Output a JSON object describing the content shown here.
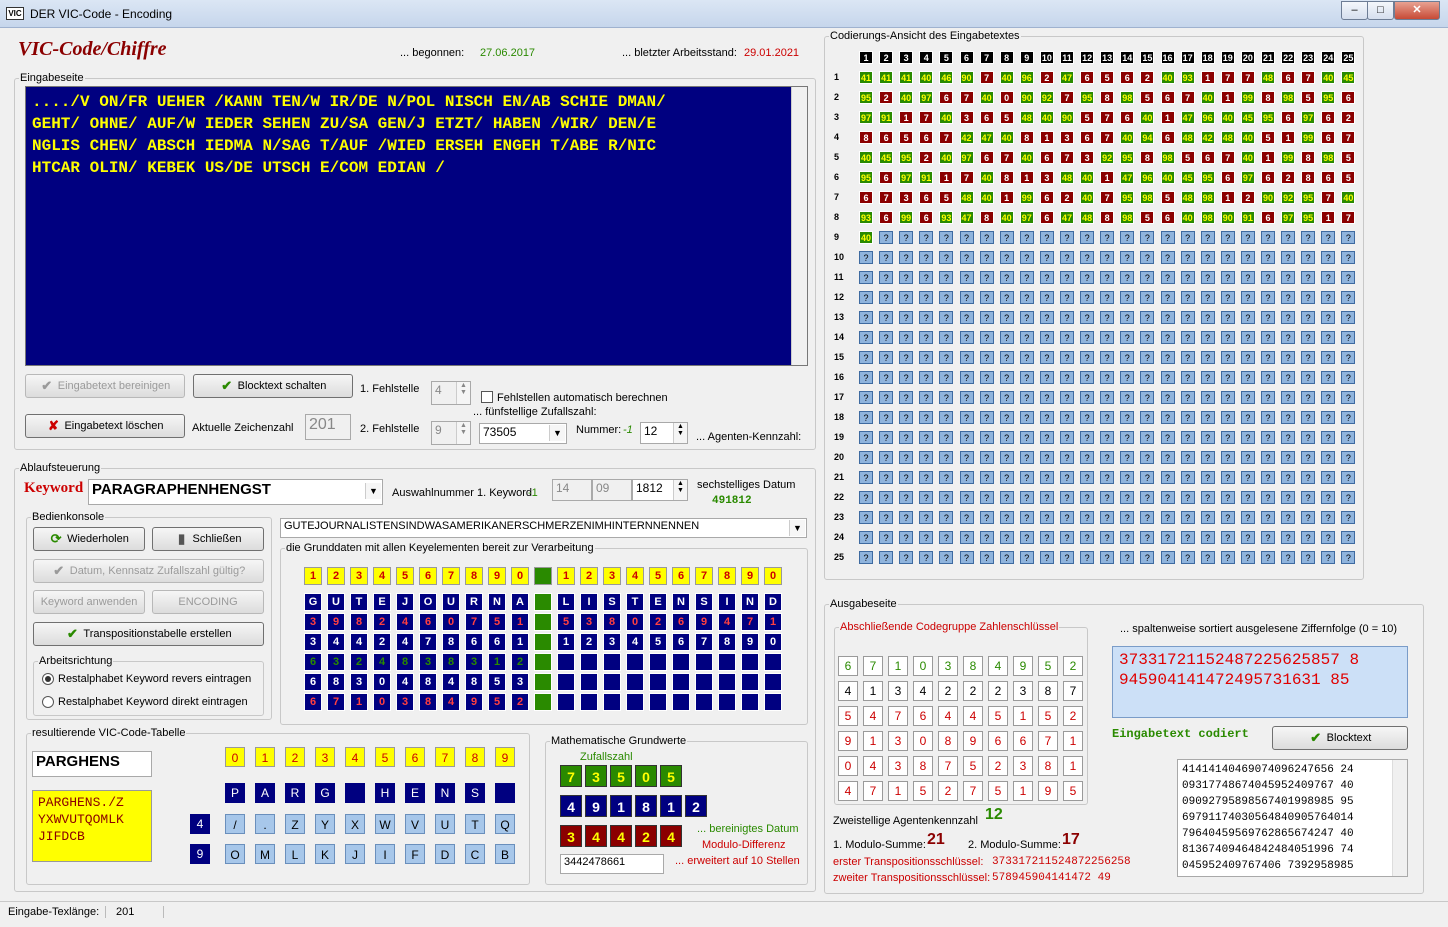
{
  "window": {
    "title": "DER VIC-Code - Encoding",
    "icon": "VIC",
    "min": "–",
    "max": "□",
    "close": "✕"
  },
  "header": {
    "app_title": "VIC-Code/Chiffre",
    "begonnen_label": "... begonnen:",
    "begonnen_value": "27.06.2017",
    "stand_label": "... bletzter Arbeitsstand:",
    "stand_value": "29.01.2021"
  },
  "eingabe": {
    "legend": "Eingabeseite",
    "lines": [
      "..../V ON/FR UEHER /KANN TEN/W IR/DE N/POL NISCH EN/AB SCHIE DMAN/",
      "GEHT/ OHNE/ AUF/W IEDER SEHEN ZU/SA GEN/J ETZT/ HABEN /WIR/ DEN/E",
      "NGLIS CHEN/ ABSCH IEDMA N/SAG T/AUF /WIED ERSEH ENGEH T/ABE R/NIC",
      "HTCAR OLIN/ KEBEK US/DE UTSCH E/COM EDIAN /"
    ]
  },
  "controls": {
    "bereinigen": "Eingabetext bereinigen",
    "blocktext": "Blocktext schalten",
    "loeschen": "Eingabetext löschen",
    "zeichenzahl_label": "Aktuelle Zeichenzahl",
    "zeichenzahl": "201",
    "f1_label": "1. Fehlstelle",
    "f1": "4",
    "f2_label": "2. Fehlstelle",
    "f2": "9",
    "auto_label": "Fehlstellen automatisch berechnen",
    "zufall_label": "... fünfstellige Zufallszahl:",
    "zufall": "73505",
    "nummer_label": "Nummer:",
    "nummer_val": "-1",
    "agent": "12",
    "agent_label": "... Agenten-Kennzahl:"
  },
  "ablauf": {
    "legend": "Ablaufsteuerung",
    "keyword_label": "Keyword",
    "keyword": "PARAGRAPHENHENGST",
    "auswahl_label": "Auswahlnummer 1. Keyword",
    "auswahl_val": "-1",
    "d1": "14",
    "d2": "09",
    "d3": "1812",
    "datum_label": "sechstelliges Datum",
    "datum": "491812",
    "phrase": "GUTEJOURNALISTENSINDWASAMERIKANERSCHMERZENIMHINTERNNENNEN",
    "grund_legend": "die Grunddaten mit allen Keyelementen bereit zur Verarbeitung"
  },
  "bedien": {
    "legend": "Bedienkonsole",
    "wiederholen": "Wiederholen",
    "schliessen": "Schließen",
    "datum_check": "Datum, Kennsatz Zufallszahl gültig?",
    "keyword_anwenden": "Keyword anwenden",
    "encoding": "ENCODING",
    "transposition": "Transpositionstabelle erstellen",
    "richtung_legend": "Arbeitsrichtung",
    "radio1": "Restalphabet Keyword revers eintragen",
    "radio2": "Restalphabet Keyword direkt eintragen"
  },
  "key_grid": {
    "header": [
      "1",
      "2",
      "3",
      "4",
      "5",
      "6",
      "7",
      "8",
      "9",
      "0",
      "",
      "1",
      "2",
      "3",
      "4",
      "5",
      "6",
      "7",
      "8",
      "9",
      "0"
    ],
    "rows": [
      [
        "G",
        "U",
        "T",
        "E",
        "J",
        "O",
        "U",
        "R",
        "N",
        "A",
        "",
        "L",
        "I",
        "S",
        "T",
        "E",
        "N",
        "S",
        "I",
        "N",
        "D"
      ],
      [
        "3",
        "9",
        "8",
        "2",
        "4",
        "6",
        "0",
        "7",
        "5",
        "1",
        "",
        "5",
        "3",
        "8",
        "0",
        "2",
        "6",
        "9",
        "4",
        "7",
        "1"
      ],
      [
        "3",
        "4",
        "4",
        "2",
        "4",
        "7",
        "8",
        "6",
        "6",
        "1",
        "",
        "1",
        "2",
        "3",
        "4",
        "5",
        "6",
        "7",
        "8",
        "9",
        "0"
      ],
      [
        "6",
        "3",
        "2",
        "4",
        "8",
        "3",
        "8",
        "3",
        "1",
        "2",
        "",
        "",
        "",
        "",
        "",
        "",
        "",
        "",
        "",
        "",
        ""
      ],
      [
        "6",
        "8",
        "3",
        "0",
        "4",
        "8",
        "4",
        "8",
        "5",
        "3",
        "",
        "",
        "",
        "",
        "",
        "",
        "",
        "",
        "",
        "",
        ""
      ],
      [
        "6",
        "7",
        "1",
        "0",
        "3",
        "8",
        "4",
        "9",
        "5",
        "2",
        "",
        "",
        "",
        "",
        "",
        "",
        "",
        "",
        "",
        "",
        ""
      ]
    ]
  },
  "vic_table": {
    "legend": "resultierende VIC-Code-Tabelle",
    "word": "PARGHENS",
    "alphabet": [
      "PARGHENS./Z",
      "YXWVUTQOMLK",
      "JIFDCB"
    ],
    "header": [
      "0",
      "1",
      "2",
      "3",
      "4",
      "5",
      "6",
      "7",
      "8",
      "9"
    ],
    "row0": [
      "P",
      "A",
      "R",
      "G",
      "",
      "H",
      "E",
      "N",
      "S",
      ""
    ],
    "row4_label": "4",
    "row4": [
      "/",
      ".",
      "Z",
      "Y",
      "X",
      "W",
      "V",
      "U",
      "T",
      "Q"
    ],
    "row9_label": "9",
    "row9": [
      "O",
      "M",
      "L",
      "K",
      "J",
      "I",
      "F",
      "D",
      "C",
      "B"
    ]
  },
  "math": {
    "legend": "Mathematische Grundwerte",
    "zufall_label": "Zufallszahl",
    "zufall": [
      "7",
      "3",
      "5",
      "0",
      "5"
    ],
    "datum": [
      "4",
      "9",
      "1",
      "8",
      "1",
      "2"
    ],
    "diff": [
      "3",
      "4",
      "4",
      "2",
      "4"
    ],
    "bereinigt": "... bereinigtes Datum",
    "modulo": "Modulo-Differenz",
    "ext": "3442478661",
    "ext_label": "... erweitert auf 10 Stellen"
  },
  "codierung": {
    "legend": "Codierungs-Ansicht des Eingabetextes",
    "cols": [
      "1",
      "2",
      "3",
      "4",
      "5",
      "6",
      "7",
      "8",
      "9",
      "10",
      "11",
      "12",
      "13",
      "14",
      "15",
      "16",
      "17",
      "18",
      "19",
      "20",
      "21",
      "22",
      "23",
      "24",
      "25"
    ],
    "rows": [
      [
        "41",
        "41",
        "41",
        "40",
        "46",
        "90",
        "7",
        "40",
        "96",
        "2",
        "47",
        "6",
        "5",
        "6",
        "2",
        "40",
        "93",
        "1",
        "7",
        "7",
        "48",
        "6",
        "7",
        "40",
        "45"
      ],
      [
        "95",
        "2",
        "40",
        "97",
        "6",
        "7",
        "40",
        "0",
        "90",
        "92",
        "7",
        "95",
        "8",
        "98",
        "5",
        "6",
        "7",
        "40",
        "1",
        "99",
        "8",
        "98",
        "5",
        "95",
        "6"
      ],
      [
        "97",
        "91",
        "1",
        "7",
        "40",
        "3",
        "6",
        "5",
        "48",
        "40",
        "90",
        "5",
        "7",
        "6",
        "40",
        "1",
        "47",
        "96",
        "40",
        "45",
        "95",
        "6",
        "97",
        "6",
        "2"
      ],
      [
        "8",
        "6",
        "5",
        "6",
        "7",
        "42",
        "47",
        "40",
        "8",
        "1",
        "3",
        "6",
        "7",
        "40",
        "94",
        "6",
        "48",
        "42",
        "48",
        "40",
        "5",
        "1",
        "99",
        "6",
        "7"
      ],
      [
        "40",
        "45",
        "95",
        "2",
        "40",
        "97",
        "6",
        "7",
        "40",
        "6",
        "7",
        "3",
        "92",
        "95",
        "8",
        "98",
        "5",
        "6",
        "7",
        "40",
        "1",
        "99",
        "8",
        "98",
        "5"
      ],
      [
        "95",
        "6",
        "97",
        "91",
        "1",
        "7",
        "40",
        "8",
        "1",
        "3",
        "48",
        "40",
        "1",
        "47",
        "96",
        "40",
        "45",
        "95",
        "6",
        "97",
        "6",
        "2",
        "8",
        "6",
        "5"
      ],
      [
        "6",
        "7",
        "3",
        "6",
        "5",
        "48",
        "40",
        "1",
        "99",
        "6",
        "2",
        "40",
        "7",
        "95",
        "98",
        "5",
        "48",
        "98",
        "1",
        "2",
        "90",
        "92",
        "95",
        "7",
        "40"
      ],
      [
        "93",
        "6",
        "99",
        "6",
        "93",
        "47",
        "8",
        "40",
        "97",
        "6",
        "47",
        "48",
        "8",
        "98",
        "5",
        "6",
        "40",
        "98",
        "90",
        "91",
        "6",
        "97",
        "95",
        "1",
        "7"
      ],
      [
        "40"
      ]
    ]
  },
  "ausgabe": {
    "legend": "Ausgabeseite",
    "schluessel_legend": "Abschließende Codegruppe Zahlenschlüssel",
    "keygrid": [
      [
        "6",
        "7",
        "1",
        "0",
        "3",
        "8",
        "4",
        "9",
        "5",
        "2"
      ],
      [
        "4",
        "1",
        "3",
        "4",
        "2",
        "2",
        "2",
        "3",
        "8",
        "7"
      ],
      [
        "5",
        "4",
        "7",
        "6",
        "4",
        "4",
        "5",
        "1",
        "5",
        "2"
      ],
      [
        "9",
        "1",
        "3",
        "0",
        "8",
        "9",
        "6",
        "6",
        "7",
        "1"
      ],
      [
        "0",
        "4",
        "3",
        "8",
        "7",
        "5",
        "2",
        "3",
        "8",
        "1"
      ],
      [
        "4",
        "7",
        "1",
        "5",
        "2",
        "7",
        "5",
        "1",
        "9",
        "5"
      ]
    ],
    "sortiert_label": "... spaltenweise sortiert ausgelesene Ziffernfolge (0 = 10)",
    "sortiert": [
      "37331721152487225625857 8",
      "945904141472495731631 85"
    ],
    "codiert_label": "Eingabetext codiert",
    "blocktext": "Blocktext",
    "output_lines": [
      "41414140469074096247656 24",
      "09317748674045952409767 40",
      "09092795898567401998985 95",
      "69791174030564840905764014",
      "79640459569762865674247 40",
      "81367409464842484051996 74",
      "045952409767406 7392958985"
    ],
    "agent_label": "Zweistellige Agentenkennzahl",
    "agent": "12",
    "mod1_label": "1. Modulo-Summe:",
    "mod1": "21",
    "mod2_label": "2. Modulo-Summe:",
    "mod2": "17",
    "t1_label": "erster Transpositionsschlüssel:",
    "t1": "373317211524872256258",
    "t2_label": "zweiter Transpositionsschlüssel:",
    "t2": "578945904141472 49"
  },
  "statusbar": {
    "label": "Eingabe-Texlänge:",
    "value": "201"
  }
}
